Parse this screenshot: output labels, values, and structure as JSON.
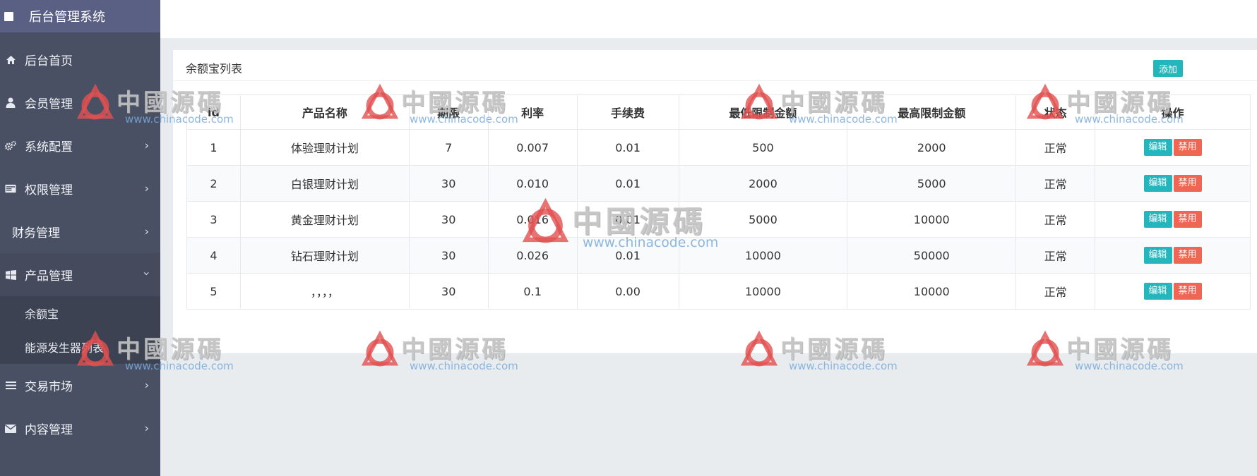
{
  "brand": {
    "title": "后台管理系统"
  },
  "sidebar": {
    "items": [
      {
        "label": "后台首页",
        "icon": "home-icon"
      },
      {
        "label": "会员管理",
        "icon": "user-icon"
      },
      {
        "label": "系统配置",
        "icon": "cogs-icon"
      },
      {
        "label": "权限管理",
        "icon": "card-icon"
      },
      {
        "label": "财务管理",
        "icon": ""
      },
      {
        "label": "产品管理",
        "icon": "windows-icon",
        "expanded": true,
        "children": [
          {
            "label": "余额宝"
          },
          {
            "label": "能源发生器列表"
          }
        ]
      },
      {
        "label": "交易市场",
        "icon": "bars-icon"
      },
      {
        "label": "内容管理",
        "icon": "envelope-icon"
      }
    ]
  },
  "panel": {
    "title": "余额宝列表",
    "add_label": "添加"
  },
  "table": {
    "headers": [
      "id",
      "产品名称",
      "期限",
      "利率",
      "手续费",
      "最低限制金额",
      "最高限制金额",
      "状态",
      "操作"
    ],
    "rows": [
      [
        "1",
        "体验理财计划",
        "7",
        "0.007",
        "0.01",
        "500",
        "2000",
        "正常"
      ],
      [
        "2",
        "白银理财计划",
        "30",
        "0.010",
        "0.01",
        "2000",
        "5000",
        "正常"
      ],
      [
        "3",
        "黄金理财计划",
        "30",
        "0.016",
        "0.01",
        "5000",
        "10000",
        "正常"
      ],
      [
        "4",
        "钻石理财计划",
        "30",
        "0.026",
        "0.01",
        "10000",
        "50000",
        "正常"
      ],
      [
        "5",
        "，，，，",
        "30",
        "0.1",
        "0.00",
        "10000",
        "10000",
        "正常"
      ]
    ],
    "edit_label": "编辑",
    "ban_label": "禁用"
  },
  "watermark": {
    "text": "中國源碼",
    "url": "www.chinacode.com"
  },
  "colors": {
    "sidebar": "#4a5064",
    "brand": "#5a5f84",
    "accent": "#23b7bd",
    "danger": "#ef6754"
  }
}
